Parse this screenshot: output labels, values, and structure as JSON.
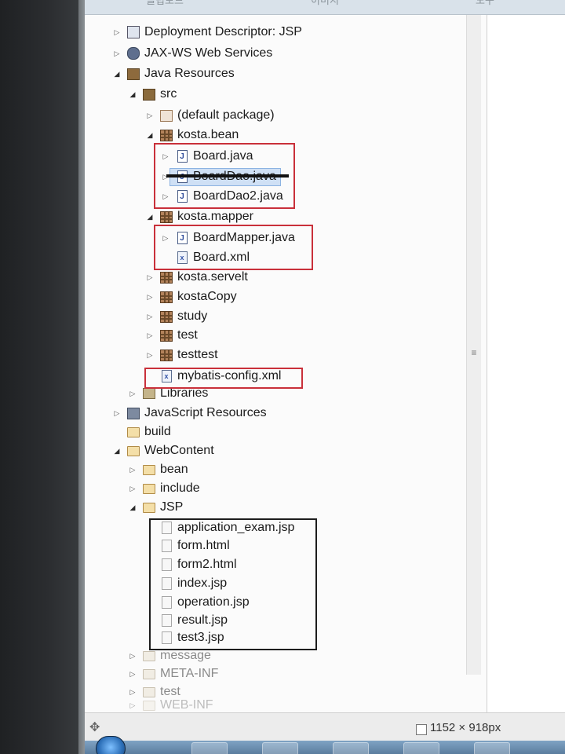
{
  "top_tabs": [
    "클립보드",
    "이미지",
    "도구"
  ],
  "tree": {
    "deployment_descriptor": "Deployment Descriptor: JSP",
    "jax_ws": "JAX-WS Web Services",
    "java_resources": "Java Resources",
    "src": "src",
    "default_package": "(default package)",
    "kosta_bean": "kosta.bean",
    "board_java": "Board.java",
    "boarddao_java": "BoardDao.java",
    "boarddao2_java": "BoardDao2.java",
    "kosta_mapper": "kosta.mapper",
    "boardmapper_java": "BoardMapper.java",
    "board_xml": "Board.xml",
    "kosta_servelt": "kosta.servelt",
    "kostacopy": "kostaCopy",
    "study": "study",
    "test": "test",
    "testtest": "testtest",
    "mybatis_config": "mybatis-config.xml",
    "libraries": "Libraries",
    "javascript_resources": "JavaScript Resources",
    "build": "build",
    "webcontent": "WebContent",
    "bean": "bean",
    "include": "include",
    "jsp": "JSP",
    "jsp_files": [
      "application_exam.jsp",
      "form.html",
      "form2.html",
      "index.jsp",
      "operation.jsp",
      "result.jsp",
      "test3.jsp"
    ],
    "message": "message",
    "meta_inf": "META-INF",
    "test_folder": "test",
    "web_inf": "WEB-INF"
  },
  "status": {
    "dimensions": "1152 × 918px"
  },
  "icons": {
    "expand": "triangle-right-icon",
    "collapse": "triangle-down-icon",
    "move": "move-icon"
  },
  "colors": {
    "highlight_red": "#c9303a",
    "highlight_black": "#1d1d1d",
    "selection": "#cfe0f5"
  }
}
